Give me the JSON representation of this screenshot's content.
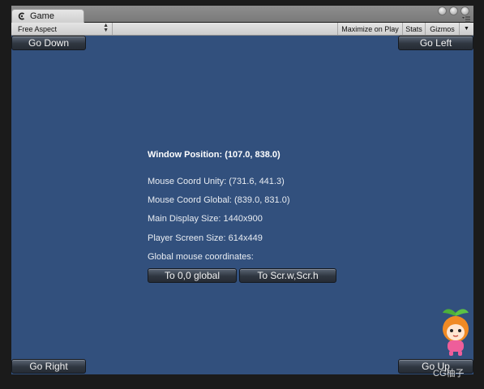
{
  "window": {
    "tab_title": "Game",
    "tab_icon": "unity-icon",
    "controls": [
      "window-dot",
      "window-dot",
      "window-dot"
    ],
    "menu_icon": "menu-icon"
  },
  "toolbar": {
    "aspect_value": "Free Aspect",
    "maximize_label": "Maximize on Play",
    "stats_label": "Stats",
    "gizmos_label": "Gizmos"
  },
  "game": {
    "background": "#32507d",
    "buttons": {
      "go_down": "Go Down",
      "go_left": "Go Left",
      "go_right": "Go Right",
      "go_up": "Go Up",
      "to_global": "To 0,0 global",
      "to_scr": "To Scr.w,Scr.h"
    },
    "info": {
      "window_position": "Window Position: (107.0, 838.0)",
      "mouse_unity": "Mouse Coord  Unity: (731.6, 441.3)",
      "mouse_global": "Mouse Coord Global: (839.0, 831.0)",
      "main_display": "Main Display  Size: 1440x900",
      "player_screen": "Player Screen Size: 614x449",
      "global_mouse": "Global mouse coordinates:"
    }
  },
  "watermark": {
    "text": "CG柚子",
    "icon": "mascot-logo"
  }
}
